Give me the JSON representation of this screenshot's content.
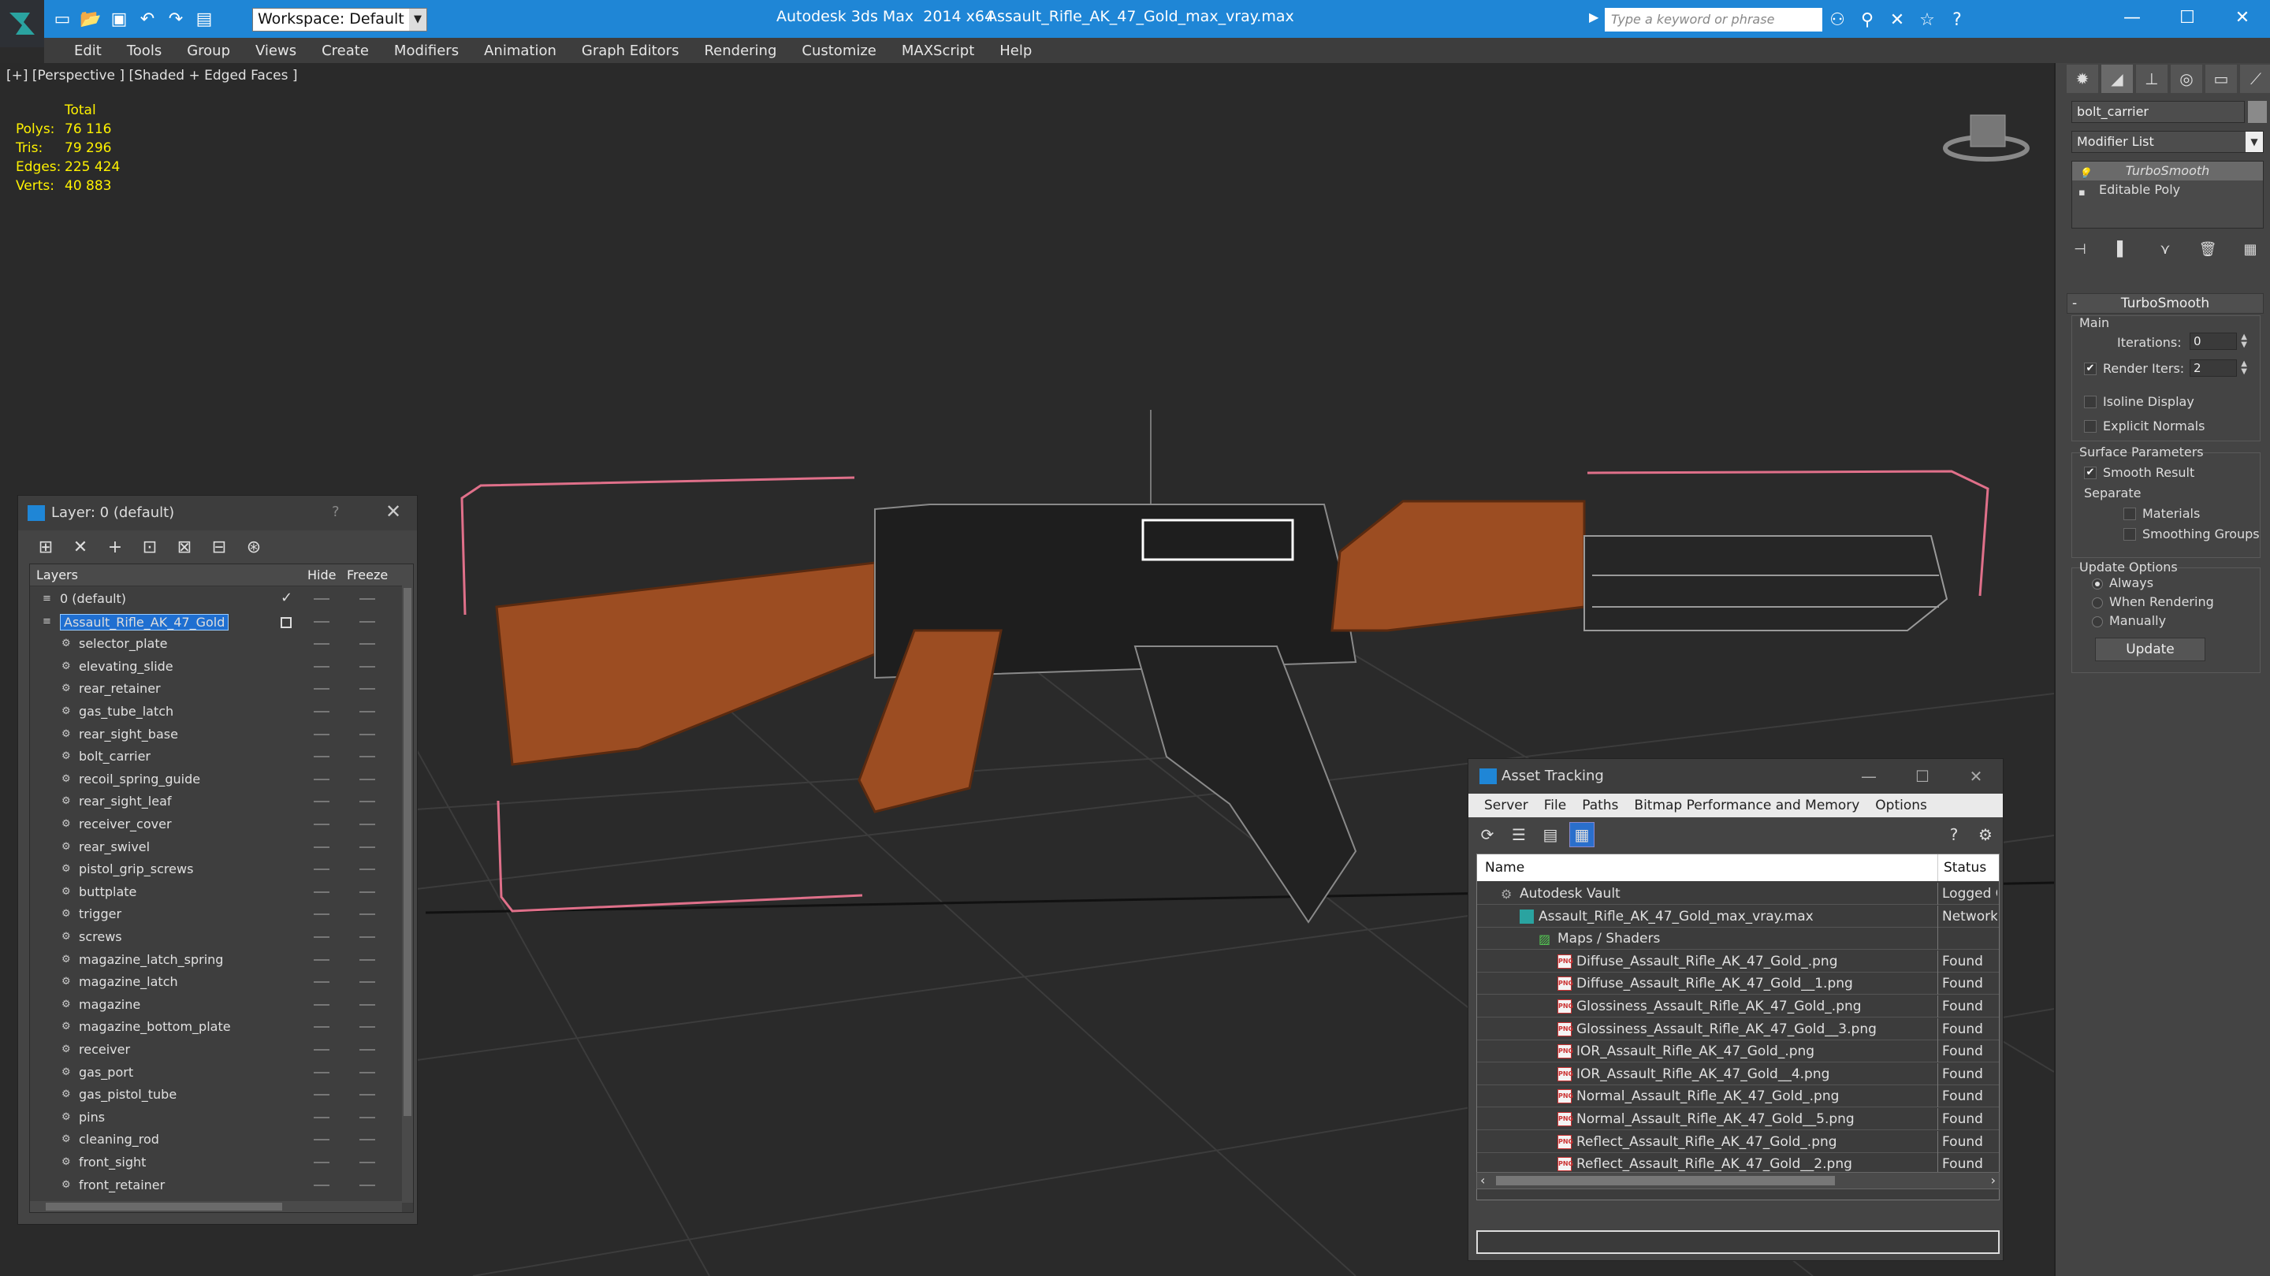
{
  "titlebar": {
    "app_title": "Autodesk 3ds Max  2014 x64",
    "file_title": "Assault_Rifle_AK_47_Gold_max_vray.max",
    "workspace": "Workspace: Default",
    "search_placeholder": "Type a keyword or phrase",
    "accent": "#1f86d6"
  },
  "menu": [
    "Edit",
    "Tools",
    "Group",
    "Views",
    "Create",
    "Modifiers",
    "Animation",
    "Graph Editors",
    "Rendering",
    "Customize",
    "MAXScript",
    "Help"
  ],
  "viewport": {
    "label": "[+] [Perspective ] [Shaded + Edged Faces ]",
    "stats_header": "Total",
    "stats": [
      {
        "k": "Polys:",
        "v": "76 116"
      },
      {
        "k": "Tris:",
        "v": "79 296"
      },
      {
        "k": "Edges:",
        "v": "225 424"
      },
      {
        "k": "Verts:",
        "v": "40 883"
      }
    ],
    "stats_color": "#fff200"
  },
  "command_panel": {
    "object_name": "bolt_carrier",
    "modifier_list": "Modifier List",
    "stack": [
      "TurboSmooth",
      "Editable Poly"
    ],
    "turbosmooth": {
      "title": "TurboSmooth",
      "main_label": "Main",
      "iterations_label": "Iterations:",
      "iterations": "0",
      "render_iters_label": "Render Iters:",
      "render_iters": "2",
      "isoline": "Isoline Display",
      "explicit": "Explicit Normals",
      "surface_label": "Surface Parameters",
      "smooth_result": "Smooth Result",
      "separate_label": "Separate",
      "materials": "Materials",
      "smoothing_groups": "Smoothing Groups",
      "update_label": "Update Options",
      "always": "Always",
      "when_rendering": "When Rendering",
      "manually": "Manually",
      "update_btn": "Update"
    }
  },
  "layer_panel": {
    "title": "Layer: 0 (default)",
    "col_layers": "Layers",
    "col_hide": "Hide",
    "col_freeze": "Freeze",
    "rows": [
      {
        "name": "0 (default)",
        "level": 0
      },
      {
        "name": "Assault_Rifle_AK_47_Gold",
        "level": 0
      },
      {
        "name": "selector_plate",
        "level": 1
      },
      {
        "name": "elevating_slide",
        "level": 1
      },
      {
        "name": "rear_retainer",
        "level": 1
      },
      {
        "name": "gas_tube_latch",
        "level": 1
      },
      {
        "name": "rear_sight_base",
        "level": 1
      },
      {
        "name": "bolt_carrier",
        "level": 1
      },
      {
        "name": "recoil_spring_guide",
        "level": 1
      },
      {
        "name": "rear_sight_leaf",
        "level": 1
      },
      {
        "name": "receiver_cover",
        "level": 1
      },
      {
        "name": "rear_swivel",
        "level": 1
      },
      {
        "name": "pistol_grip_screws",
        "level": 1
      },
      {
        "name": "buttplate",
        "level": 1
      },
      {
        "name": "trigger",
        "level": 1
      },
      {
        "name": "screws",
        "level": 1
      },
      {
        "name": "magazine_latch_spring",
        "level": 1
      },
      {
        "name": "magazine_latch",
        "level": 1
      },
      {
        "name": "magazine",
        "level": 1
      },
      {
        "name": "magazine_bottom_plate",
        "level": 1
      },
      {
        "name": "receiver",
        "level": 1
      },
      {
        "name": "gas_port",
        "level": 1
      },
      {
        "name": "gas_pistol_tube",
        "level": 1
      },
      {
        "name": "pins",
        "level": 1
      },
      {
        "name": "cleaning_rod",
        "level": 1
      },
      {
        "name": "front_sight",
        "level": 1
      },
      {
        "name": "front_retainer",
        "level": 1
      }
    ]
  },
  "asset_panel": {
    "title": "Asset Tracking",
    "menu": [
      "Server",
      "File",
      "Paths",
      "Bitmap Performance and Memory",
      "Options"
    ],
    "col_name": "Name",
    "col_status": "Status",
    "rows": [
      {
        "name": "Autodesk Vault",
        "status": "Logged Out",
        "level": 0,
        "icon": "vault"
      },
      {
        "name": "Assault_Rifle_AK_47_Gold_max_vray.max",
        "status": "Network",
        "level": 1,
        "icon": "max"
      },
      {
        "name": "Maps / Shaders",
        "status": "",
        "level": 2,
        "icon": "maps"
      },
      {
        "name": "Diffuse_Assault_Rifle_AK_47_Gold_.png",
        "status": "Found",
        "level": 3,
        "icon": "png"
      },
      {
        "name": "Diffuse_Assault_Rifle_AK_47_Gold__1.png",
        "status": "Found",
        "level": 3,
        "icon": "png"
      },
      {
        "name": "Glossiness_Assault_Rifle_AK_47_Gold_.png",
        "status": "Found",
        "level": 3,
        "icon": "png"
      },
      {
        "name": "Glossiness_Assault_Rifle_AK_47_Gold__3.png",
        "status": "Found",
        "level": 3,
        "icon": "png"
      },
      {
        "name": "IOR_Assault_Rifle_AK_47_Gold_.png",
        "status": "Found",
        "level": 3,
        "icon": "png"
      },
      {
        "name": "IOR_Assault_Rifle_AK_47_Gold__4.png",
        "status": "Found",
        "level": 3,
        "icon": "png"
      },
      {
        "name": "Normal_Assault_Rifle_AK_47_Gold_.png",
        "status": "Found",
        "level": 3,
        "icon": "png"
      },
      {
        "name": "Normal_Assault_Rifle_AK_47_Gold__5.png",
        "status": "Found",
        "level": 3,
        "icon": "png"
      },
      {
        "name": "Reflect_Assault_Rifle_AK_47_Gold_.png",
        "status": "Found",
        "level": 3,
        "icon": "png"
      },
      {
        "name": "Reflect_Assault_Rifle_AK_47_Gold__2.png",
        "status": "Found",
        "level": 3,
        "icon": "png"
      }
    ]
  }
}
